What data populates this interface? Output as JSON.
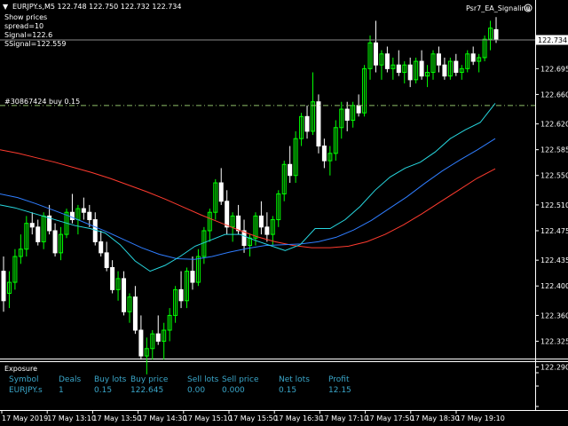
{
  "header": {
    "symbol_quote": "EURJPY.s,M5  122.748 122.750 122.732 122.734",
    "indicator": "Psr7_EA_Signaline",
    "info_lines": [
      "Show prices",
      "spread=10",
      "Signal=122.6",
      "SSignal=122.559"
    ]
  },
  "order_label": "#30867424 buy 0.15",
  "price_tag": "122.734",
  "colors": {
    "bull": "#00ff00",
    "bear": "#ffffff",
    "ma_red": "#ff3b2f",
    "ma_blue": "#2f7dff",
    "ma_cyan": "#27d8e0",
    "order_line": "#8fbf6a",
    "exposure_text": "#3aa6c9"
  },
  "exposure": {
    "title": "Exposure",
    "headers": [
      "Symbol",
      "Deals",
      "Buy lots",
      "Buy price",
      "Sell lots",
      "Sell price",
      "Net lots",
      "Profit"
    ],
    "row": [
      "EURJPY.s",
      "1",
      "0.15",
      "122.645",
      "0.00",
      "0.000",
      "0.15",
      "12.15"
    ]
  },
  "chart_data": {
    "type": "candlestick",
    "title": "EURJPY.s,M5",
    "ylim": [
      122.26,
      122.8
    ],
    "y_ticks": [
      "122.734",
      "122.695",
      "122.660",
      "122.620",
      "122.585",
      "122.550",
      "122.510",
      "122.475",
      "122.435",
      "122.400",
      "122.360",
      "122.325",
      "122.290"
    ],
    "y_tick_values": [
      122.734,
      122.695,
      122.66,
      122.62,
      122.585,
      122.55,
      122.51,
      122.475,
      122.435,
      122.4,
      122.36,
      122.325,
      122.29
    ],
    "x_labels": [
      "17 May 2019",
      "17 May 13:10",
      "17 May 13:50",
      "17 May 14:30",
      "17 May 15:10",
      "17 May 15:50",
      "17 May 16:30",
      "17 May 17:10",
      "17 May 17:50",
      "17 May 18:30",
      "17 May 19:10"
    ],
    "order_price": 122.645,
    "current_price": 122.734,
    "candles_ohlc": [
      [
        122.42,
        122.44,
        122.365,
        122.38
      ],
      [
        122.39,
        122.42,
        122.37,
        122.405
      ],
      [
        122.405,
        122.45,
        122.395,
        122.44
      ],
      [
        122.44,
        122.47,
        122.43,
        122.45
      ],
      [
        122.45,
        122.495,
        122.44,
        122.485
      ],
      [
        122.485,
        122.5,
        122.47,
        122.48
      ],
      [
        122.48,
        122.49,
        122.455,
        122.46
      ],
      [
        122.46,
        122.5,
        122.45,
        122.495
      ],
      [
        122.495,
        122.51,
        122.47,
        122.475
      ],
      [
        122.475,
        122.485,
        122.44,
        122.445
      ],
      [
        122.445,
        122.48,
        122.435,
        122.47
      ],
      [
        122.47,
        122.505,
        122.465,
        122.5
      ],
      [
        122.5,
        122.525,
        122.485,
        122.49
      ],
      [
        122.49,
        122.51,
        122.47,
        122.505
      ],
      [
        122.505,
        122.52,
        122.49,
        122.5
      ],
      [
        122.5,
        122.51,
        122.48,
        122.49
      ],
      [
        122.49,
        122.5,
        122.455,
        122.46
      ],
      [
        122.46,
        122.475,
        122.44,
        122.445
      ],
      [
        122.445,
        122.46,
        122.42,
        122.425
      ],
      [
        122.425,
        122.435,
        122.39,
        122.395
      ],
      [
        122.395,
        122.42,
        122.38,
        122.41
      ],
      [
        122.41,
        122.42,
        122.36,
        122.365
      ],
      [
        122.365,
        122.39,
        122.35,
        122.385
      ],
      [
        122.385,
        122.4,
        122.335,
        122.34
      ],
      [
        122.34,
        122.36,
        122.3,
        122.305
      ],
      [
        122.305,
        122.33,
        122.28,
        122.315
      ],
      [
        122.315,
        122.34,
        122.3,
        122.335
      ],
      [
        122.335,
        122.36,
        122.32,
        122.325
      ],
      [
        122.325,
        122.35,
        122.3,
        122.34
      ],
      [
        122.34,
        122.37,
        122.325,
        122.36
      ],
      [
        122.36,
        122.4,
        122.35,
        122.395
      ],
      [
        122.395,
        122.42,
        122.37,
        122.38
      ],
      [
        122.38,
        122.425,
        122.37,
        122.42
      ],
      [
        122.42,
        122.44,
        122.395,
        122.405
      ],
      [
        122.405,
        122.45,
        122.4,
        122.44
      ],
      [
        122.44,
        122.48,
        122.43,
        122.475
      ],
      [
        122.475,
        122.505,
        122.46,
        122.5
      ],
      [
        122.5,
        122.545,
        122.49,
        122.54
      ],
      [
        122.54,
        122.56,
        122.51,
        122.515
      ],
      [
        122.515,
        122.53,
        122.47,
        122.48
      ],
      [
        122.48,
        122.5,
        122.46,
        122.495
      ],
      [
        122.495,
        122.51,
        122.47,
        122.475
      ],
      [
        122.475,
        122.49,
        122.445,
        122.455
      ],
      [
        122.455,
        122.47,
        122.44,
        122.465
      ],
      [
        122.465,
        122.5,
        122.455,
        122.495
      ],
      [
        122.495,
        122.515,
        122.47,
        122.48
      ],
      [
        122.48,
        122.5,
        122.46,
        122.47
      ],
      [
        122.47,
        122.495,
        122.455,
        122.49
      ],
      [
        122.49,
        122.53,
        122.48,
        122.525
      ],
      [
        122.525,
        122.57,
        122.515,
        122.565
      ],
      [
        122.565,
        122.59,
        122.54,
        122.55
      ],
      [
        122.55,
        122.61,
        122.54,
        122.6
      ],
      [
        122.6,
        122.635,
        122.59,
        122.63
      ],
      [
        122.63,
        122.645,
        122.6,
        122.61
      ],
      [
        122.61,
        122.69,
        122.605,
        122.65
      ],
      [
        122.65,
        122.66,
        122.58,
        122.59
      ],
      [
        122.59,
        122.6,
        122.56,
        122.57
      ],
      [
        122.57,
        122.59,
        122.55,
        122.58
      ],
      [
        122.58,
        122.625,
        122.57,
        122.615
      ],
      [
        122.615,
        122.65,
        122.6,
        122.64
      ],
      [
        122.64,
        122.65,
        122.61,
        122.625
      ],
      [
        122.625,
        122.65,
        122.615,
        122.645
      ],
      [
        122.645,
        122.66,
        122.63,
        122.635
      ],
      [
        122.635,
        122.7,
        122.63,
        122.695
      ],
      [
        122.695,
        122.74,
        122.68,
        122.73
      ],
      [
        122.73,
        122.76,
        122.69,
        122.7
      ],
      [
        122.7,
        122.72,
        122.68,
        122.715
      ],
      [
        122.715,
        122.725,
        122.69,
        122.695
      ],
      [
        122.695,
        122.71,
        122.68,
        122.7
      ],
      [
        122.7,
        122.72,
        122.685,
        122.69
      ],
      [
        122.69,
        122.705,
        122.675,
        122.7
      ],
      [
        122.7,
        122.71,
        122.67,
        122.68
      ],
      [
        122.68,
        122.71,
        122.675,
        122.705
      ],
      [
        122.705,
        122.72,
        122.68,
        122.685
      ],
      [
        122.685,
        122.7,
        122.67,
        122.69
      ],
      [
        122.69,
        122.72,
        122.68,
        122.715
      ],
      [
        122.715,
        122.725,
        122.69,
        122.7
      ],
      [
        122.7,
        122.71,
        122.68,
        122.685
      ],
      [
        122.685,
        122.71,
        122.68,
        122.705
      ],
      [
        122.705,
        122.715,
        122.685,
        122.69
      ],
      [
        122.69,
        122.7,
        122.68,
        122.695
      ],
      [
        122.695,
        122.72,
        122.69,
        122.715
      ],
      [
        122.715,
        122.725,
        122.7,
        122.705
      ],
      [
        122.705,
        122.715,
        122.69,
        122.71
      ],
      [
        122.71,
        122.74,
        122.705,
        122.735
      ],
      [
        122.735,
        122.76,
        122.72,
        122.75
      ],
      [
        122.748,
        122.765,
        122.73,
        122.734
      ]
    ],
    "series": [
      {
        "name": "",
        "color": "#ff3b2f",
        "values": [
          122.585,
          122.58,
          122.574,
          122.568,
          122.561,
          122.554,
          122.546,
          122.537,
          122.528,
          122.518,
          122.507,
          122.496,
          122.486,
          122.476,
          122.467,
          122.46,
          122.455,
          122.452,
          122.452,
          122.454,
          122.46,
          122.47,
          122.483,
          122.498,
          122.514,
          122.53,
          122.546,
          122.559
        ]
      },
      {
        "name": "",
        "color": "#2f7dff",
        "values": [
          122.525,
          122.52,
          122.512,
          122.503,
          122.494,
          122.484,
          122.474,
          122.463,
          122.452,
          122.443,
          122.437,
          122.436,
          122.44,
          122.446,
          122.451,
          122.455,
          122.456,
          122.457,
          122.46,
          122.466,
          122.476,
          122.489,
          122.505,
          122.521,
          122.539,
          122.556,
          122.571,
          122.585,
          122.6
        ]
      },
      {
        "name": "",
        "color": "#27d8e0",
        "values": [
          122.51,
          122.506,
          122.5,
          122.494,
          122.488,
          122.482,
          122.478,
          122.472,
          122.456,
          122.434,
          122.42,
          122.428,
          122.44,
          122.454,
          122.462,
          122.47,
          122.47,
          122.462,
          122.455,
          122.448,
          122.456,
          122.478,
          122.478,
          122.49,
          122.508,
          122.53,
          122.548,
          122.56,
          122.568,
          122.582,
          122.6,
          122.612,
          122.622,
          122.648
        ]
      }
    ]
  }
}
